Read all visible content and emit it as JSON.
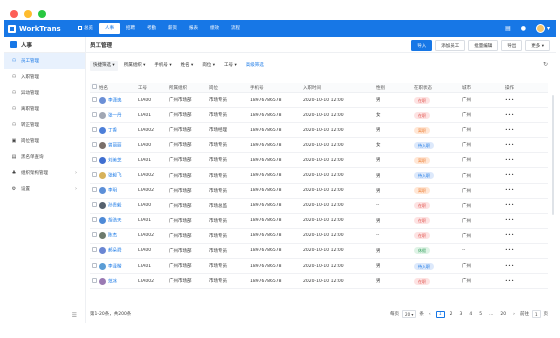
{
  "window": {
    "dots": [
      "#fd5f57",
      "#febc2e",
      "#28c840"
    ]
  },
  "app": {
    "name": "WorkTrans",
    "brand_color": "#1777e6"
  },
  "topnav": {
    "home_label": "总览",
    "items": [
      {
        "label": "人事",
        "active": true
      },
      {
        "label": "招聘",
        "active": false
      },
      {
        "label": "考勤",
        "active": false
      },
      {
        "label": "薪资",
        "active": false
      },
      {
        "label": "报表",
        "active": false
      },
      {
        "label": "绩效",
        "active": false
      },
      {
        "label": "流程",
        "active": false
      }
    ],
    "user_caret": "▾"
  },
  "sidebar": {
    "title": "人事",
    "items": [
      {
        "label": "员工管理",
        "icon": "user-icon",
        "glyph": "⚇",
        "active": true,
        "has_chevron": false
      },
      {
        "label": "入职管理",
        "icon": "user-add-icon",
        "glyph": "⚇",
        "active": false,
        "has_chevron": false
      },
      {
        "label": "异动管理",
        "icon": "user-transfer-icon",
        "glyph": "⚇",
        "active": false,
        "has_chevron": false
      },
      {
        "label": "离职管理",
        "icon": "user-remove-icon",
        "glyph": "⚇",
        "active": false,
        "has_chevron": false
      },
      {
        "label": "转正管理",
        "icon": "user-check-icon",
        "glyph": "⚇",
        "active": false,
        "has_chevron": false
      },
      {
        "label": "岗位管理",
        "icon": "briefcase-icon",
        "glyph": "▣",
        "active": false,
        "has_chevron": false
      },
      {
        "label": "黑名单查询",
        "icon": "list-icon",
        "glyph": "▤",
        "active": false,
        "has_chevron": false
      },
      {
        "label": "组织架构管理",
        "icon": "org-chart-icon",
        "glyph": "♣",
        "active": false,
        "has_chevron": true
      },
      {
        "label": "设置",
        "icon": "gear-icon",
        "glyph": "⚙",
        "active": false,
        "has_chevron": true
      }
    ]
  },
  "main": {
    "title": "员工管理",
    "actions": [
      {
        "label": "导入",
        "primary": true,
        "name": "import-button"
      },
      {
        "label": "添加员工",
        "primary": false,
        "name": "add-employee-button"
      },
      {
        "label": "批量编辑",
        "primary": false,
        "name": "batch-edit-button"
      },
      {
        "label": "导出",
        "primary": false,
        "name": "export-button"
      },
      {
        "label": "更多 ▾",
        "primary": false,
        "name": "more-button"
      }
    ],
    "filters": [
      {
        "label": "快捷筛选 ▾",
        "style": "boxed"
      },
      {
        "label": "所属组织 ▾",
        "style": "plain"
      },
      {
        "label": "手机号 ▾",
        "style": "plain"
      },
      {
        "label": "姓名 ▾",
        "style": "plain"
      },
      {
        "label": "岗位 ▾",
        "style": "plain"
      },
      {
        "label": "工号 ▾",
        "style": "plain"
      },
      {
        "label": "高级筛选",
        "style": "link"
      }
    ]
  },
  "table": {
    "columns": [
      "姓名",
      "工号",
      "所属组织",
      "岗位",
      "手机号",
      "入职时间",
      "性别",
      "在职状态",
      "城市",
      "操作"
    ],
    "status_styles": {
      "在职": {
        "bg": "#fde3e3",
        "fg": "#e0504a"
      },
      "离职": {
        "bg": "#ffe7d6",
        "fg": "#ed7a2f"
      },
      "待入职": {
        "bg": "#dde9fb",
        "fg": "#1777e6"
      },
      "休假": {
        "bg": "#dff3e6",
        "fg": "#2f9e5a"
      }
    },
    "rows": [
      {
        "name": "李潇逸",
        "avatar": "#6b8fd6",
        "id": "LTA00",
        "org": "广州市场部",
        "post": "市场专员",
        "phone": "18976786578",
        "date": "2020-10-10",
        "time": "12:00",
        "gender": "男",
        "status": "在职",
        "city": "广州",
        "op": "•••"
      },
      {
        "name": "张一丹",
        "avatar": "#a1a7b3",
        "id": "LTA01",
        "org": "广州市场部",
        "post": "市场专员",
        "phone": "18976786578",
        "date": "2020-10-10",
        "time": "12:00",
        "gender": "女",
        "status": "在职",
        "city": "广州",
        "op": "•••"
      },
      {
        "name": "丁香",
        "avatar": "#4d7fd9",
        "id": "LTA002",
        "org": "广州市场部",
        "post": "市场经理",
        "phone": "18976786578",
        "date": "2020-10-10",
        "time": "12:00",
        "gender": "男",
        "status": "离职",
        "city": "广州",
        "op": "•••"
      },
      {
        "name": "曾丽丽",
        "avatar": "#7a6f69",
        "id": "LTA00",
        "org": "广州市场部",
        "post": "市场专员",
        "phone": "18976786578",
        "date": "2020-10-10",
        "time": "12:00",
        "gender": "女",
        "status": "待入职",
        "city": "广州",
        "op": "•••"
      },
      {
        "name": "刘美芝",
        "avatar": "#3f6fd1",
        "id": "LTA01",
        "org": "广州市场部",
        "post": "市场专员",
        "phone": "18976786578",
        "date": "2020-10-10",
        "time": "12:00",
        "gender": "男",
        "status": "离职",
        "city": "广州",
        "op": "•••"
      },
      {
        "name": "张毅飞",
        "avatar": "#d7b25a",
        "id": "LTA002",
        "org": "广州市场部",
        "post": "市场专员",
        "phone": "18976786578",
        "date": "2020-10-10",
        "time": "12:00",
        "gender": "男",
        "status": "待入职",
        "city": "广州",
        "op": "•••"
      },
      {
        "name": "李玥",
        "avatar": "#5c8fd8",
        "id": "LTA002",
        "org": "广州市场部",
        "post": "市场专员",
        "phone": "18976786578",
        "date": "2020-10-10",
        "time": "12:00",
        "gender": "男",
        "status": "离职",
        "city": "广州",
        "op": "•••"
      },
      {
        "name": "孙贵毅",
        "avatar": "#56616e",
        "id": "LTA00",
        "org": "广州市场部",
        "post": "市场总监",
        "phone": "18976786578",
        "date": "2020-10-10",
        "time": "12:00",
        "gender": "--",
        "status": "在职",
        "city": "广州",
        "op": "•••"
      },
      {
        "name": "胡浩天",
        "avatar": "#4e8ad7",
        "id": "LTA01",
        "org": "广州市场部",
        "post": "市场专员",
        "phone": "18976786578",
        "date": "2020-10-10",
        "time": "12:00",
        "gender": "男",
        "status": "在职",
        "city": "广州",
        "op": "•••"
      },
      {
        "name": "陈杰",
        "avatar": "#6d7a6c",
        "id": "LTA002",
        "org": "广州市场部",
        "post": "市场专员",
        "phone": "18976786578",
        "date": "2020-10-10",
        "time": "12:00",
        "gender": "--",
        "status": "在职",
        "city": "广州",
        "op": "•••"
      },
      {
        "name": "郝朵舜",
        "avatar": "#6a86d3",
        "id": "LTA00",
        "org": "广州市场部",
        "post": "市场专员",
        "phone": "18976786578",
        "date": "2020-10-10",
        "time": "12:00",
        "gender": "男",
        "status": "休假",
        "city": "--",
        "op": "•••"
      },
      {
        "name": "李泽楷",
        "avatar": "#5b9dd5",
        "id": "LTA01",
        "org": "广州市场部",
        "post": "市场专员",
        "phone": "18976786578",
        "date": "2020-10-10",
        "time": "12:00",
        "gender": "男",
        "status": "待入职",
        "city": "广州",
        "op": "•••"
      },
      {
        "name": "范冰",
        "avatar": "#9a7ab3",
        "id": "LTA002",
        "org": "广州市场部",
        "post": "市场专员",
        "phone": "18976786578",
        "date": "2020-10-10",
        "time": "12:00",
        "gender": "男",
        "status": "在职",
        "city": "广州",
        "op": "•••"
      }
    ]
  },
  "footer": {
    "summary": "第1-20条，共200条",
    "per_page_prefix": "每页",
    "per_page": "20 ▾",
    "per_page_suffix": "条",
    "pages": [
      "1",
      "2",
      "3",
      "4",
      "5",
      "...",
      "20"
    ],
    "current_page": "1",
    "next": "›",
    "prev": "‹",
    "goto_label": "前往",
    "goto_value": "1",
    "goto_suffix": "页"
  }
}
